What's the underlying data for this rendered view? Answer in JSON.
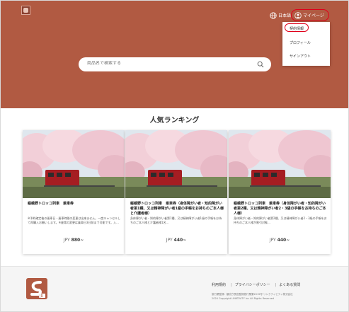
{
  "header": {
    "language": "日本語",
    "mypage": "マイページ"
  },
  "dropdown": {
    "items": [
      {
        "label": "契約情報"
      },
      {
        "label": "プロフィール"
      },
      {
        "label": "サインアウト"
      }
    ]
  },
  "search": {
    "placeholder": "商品名で検索する"
  },
  "ranking": {
    "title": "人気ランキング",
    "cards": [
      {
        "title": "嵯峨野トロッコ列車　乗車券",
        "description": "※予約確定後の乗車日・乗車時間の変更は出来ません。一度キャンセルして再購入お願いします。※座席の変更は乗車日3日前まで可能です。入…",
        "currency": "JPY",
        "price": "880~"
      },
      {
        "title": "嵯峨野トロッコ列車　乗車券（身体障がい者・知的障がい者第1種、又は精神障がい者1級の手帳をお持ちのご本人様と介護者様）",
        "description": "身体障がい者・知的障がい者第1種、又は精神障がい者1級の手帳をお持ちのご本人様と介護者様1名…",
        "currency": "JPY",
        "price": "440~"
      },
      {
        "title": "嵯峨野トロッコ列車　乗車券（身体障がい者・知的障がい者第2種、又は精神障がい者2・3級の手帳をお持ちのご本人様）",
        "description": "身体障がい者・知的障がい者第2種、又は精神障がい者2・3級の手帳をお持ちのご本人様が割引対象…",
        "currency": "JPY",
        "price": "440~"
      }
    ]
  },
  "footer": {
    "links": [
      "利用規約",
      "プライバシーポリシー",
      "よくある質問"
    ],
    "company": "旅行業登録：観光庁長官登録旅行業第2015号 リンクティビティ株式会社",
    "copyright": "2024 Copyright LINKTIVITY Inc All Rights Reserved"
  },
  "colors": {
    "brand": "#b15a42",
    "highlight": "#e0001a"
  }
}
